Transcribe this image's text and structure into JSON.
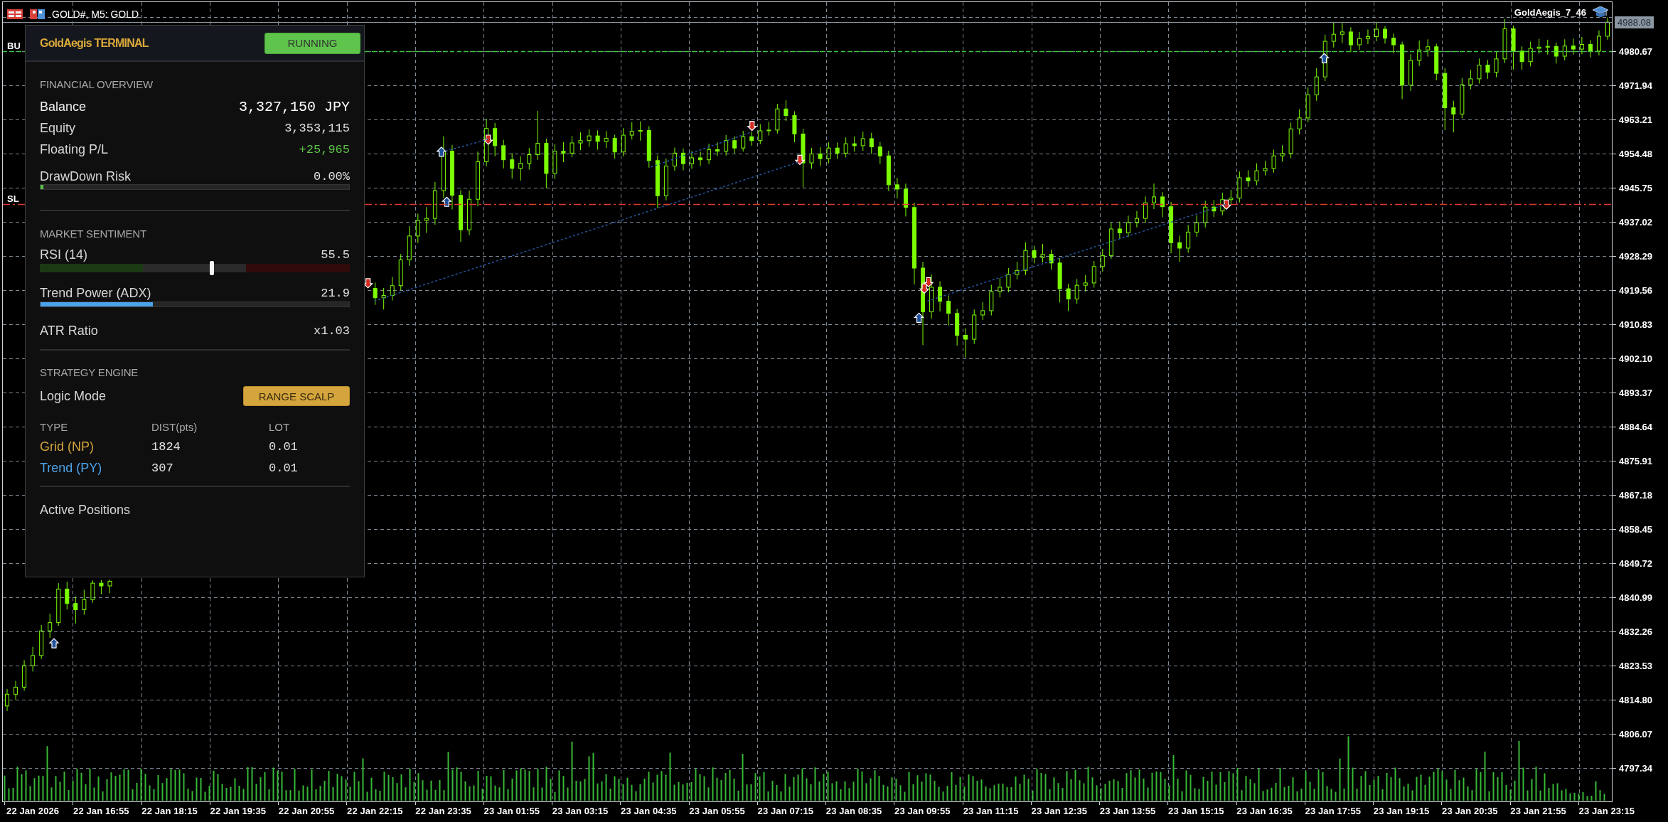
{
  "chart": {
    "title": "GOLD#, M5: GOLD",
    "expert": "GoldAegis_7_46",
    "current_price": "4988.08",
    "level_lines": [
      {
        "label": "BU",
        "kind": "buy"
      },
      {
        "label": "SL",
        "kind": "stop"
      }
    ],
    "chart_data": {
      "type": "candlestick",
      "grid": true,
      "ylim": [
        4788.79,
        4993.22
      ],
      "categories": [
        null,
        null,
        null,
        "22 Jan 2026",
        null,
        null,
        null,
        null,
        null,
        null,
        null,
        "22 Jan 16:55",
        null,
        null,
        null,
        null,
        null,
        null,
        null,
        "22 Jan 18:15",
        null,
        null,
        null,
        null,
        null,
        null,
        null,
        "22 Jan 19:35",
        null,
        null,
        null,
        null,
        null,
        null,
        null,
        "22 Jan 20:55",
        null,
        null,
        null,
        null,
        null,
        null,
        null,
        "22 Jan 22:15",
        null,
        null,
        null,
        null,
        null,
        null,
        null,
        "22 Jan 23:35",
        null,
        null,
        null,
        null,
        null,
        null,
        null,
        "23 Jan 01:55",
        null,
        null,
        null,
        null,
        null,
        null,
        null,
        "23 Jan 03:15",
        null,
        null,
        null,
        null,
        null,
        null,
        null,
        "23 Jan 04:35",
        null,
        null,
        null,
        null,
        null,
        null,
        null,
        "23 Jan 05:55",
        null,
        null,
        null,
        null,
        null,
        null,
        null,
        "23 Jan 07:15",
        null,
        null,
        null,
        null,
        null,
        null,
        null,
        "23 Jan 08:35",
        null,
        null,
        null,
        null,
        null,
        null,
        null,
        "23 Jan 09:55",
        null,
        null,
        null,
        null,
        null,
        null,
        null,
        "23 Jan 11:15",
        null,
        null,
        null,
        null,
        null,
        null,
        null,
        "23 Jan 12:35",
        null,
        null,
        null,
        null,
        null,
        null,
        null,
        "23 Jan 13:55",
        null,
        null,
        null,
        null,
        null,
        null,
        null,
        "23 Jan 15:15",
        null,
        null,
        null,
        null,
        null,
        null,
        null,
        "23 Jan 16:35",
        null,
        null,
        null,
        null,
        null,
        null,
        null,
        "23 Jan 17:55",
        null,
        null,
        null,
        null,
        null,
        null,
        null,
        "23 Jan 19:15",
        null,
        null,
        null,
        null,
        null,
        null,
        null,
        "23 Jan 20:35",
        null,
        null,
        null,
        null,
        null,
        null,
        null,
        "23 Jan 21:55",
        null,
        null,
        null,
        null,
        null,
        null,
        null,
        "23 Jan 23:15"
      ],
      "yticks": [
        {
          "value": 4980.67,
          "label": "4980.67"
        },
        {
          "value": 4971.94,
          "label": "4971.94"
        },
        {
          "value": 4963.21,
          "label": "4963.21"
        },
        {
          "value": 4954.48,
          "label": "4954.48"
        },
        {
          "value": 4945.75,
          "label": "4945.75"
        },
        {
          "value": 4937.02,
          "label": "4937.02"
        },
        {
          "value": 4928.29,
          "label": "4928.29"
        },
        {
          "value": 4919.56,
          "label": "4919.56"
        },
        {
          "value": 4910.83,
          "label": "4910.83"
        },
        {
          "value": 4902.1,
          "label": "4902.10"
        },
        {
          "value": 4893.37,
          "label": "4893.37"
        },
        {
          "value": 4884.64,
          "label": "4884.64"
        },
        {
          "value": 4875.91,
          "label": "4875.91"
        },
        {
          "value": 4867.18,
          "label": "4867.18"
        },
        {
          "value": 4858.45,
          "label": "4858.45"
        },
        {
          "value": 4849.72,
          "label": "4849.72"
        },
        {
          "value": 4840.99,
          "label": "4840.99"
        },
        {
          "value": 4832.26,
          "label": "4832.26"
        },
        {
          "value": 4823.53,
          "label": "4823.53"
        },
        {
          "value": 4814.8,
          "label": "4814.80"
        },
        {
          "value": 4806.07,
          "label": "4806.07"
        },
        {
          "value": 4797.34,
          "label": "4797.34"
        }
      ],
      "ohlc": [
        [
          4813.2,
          4817.5,
          4811.9,
          4816.2
        ],
        [
          4816.2,
          4819.6,
          4814.8,
          4818.0
        ],
        [
          4818.0,
          4824.9,
          4817.1,
          4823.5
        ],
        [
          4823.5,
          4828.3,
          4822.0,
          4826.1
        ],
        [
          4826.1,
          4833.9,
          4825.2,
          4832.4
        ],
        [
          4832.4,
          4836.8,
          4830.6,
          4834.5
        ],
        [
          4834.5,
          4844.6,
          4833.7,
          4843.1
        ],
        [
          4843.1,
          4845.0,
          4837.9,
          4839.4
        ],
        [
          4839.4,
          4841.2,
          4834.3,
          4837.8
        ],
        [
          4837.8,
          4842.9,
          4836.5,
          4840.4
        ],
        [
          4840.4,
          4845.3,
          4839.6,
          4844.6
        ],
        [
          4844.6,
          4845.4,
          4841.8,
          4843.9
        ],
        [
          4843.9,
          4845.5,
          4842.0,
          4845.1
        ],
        null,
        null,
        null,
        null,
        null,
        null,
        null,
        null,
        null,
        null,
        null,
        null,
        null,
        null,
        null,
        null,
        null,
        null,
        null,
        null,
        null,
        null,
        null,
        null,
        null,
        null,
        null,
        null,
        null,
        null,
        [
          4920.0,
          4921.5,
          4915.8,
          4917.6
        ],
        [
          4917.6,
          4920.1,
          4914.6,
          4918.2
        ],
        [
          4918.2,
          4922.9,
          4916.9,
          4920.7
        ],
        [
          4920.7,
          4928.8,
          4919.5,
          4927.3
        ],
        [
          4927.3,
          4935.9,
          4925.8,
          4933.4
        ],
        [
          4933.4,
          4939.1,
          4931.6,
          4937.4
        ],
        [
          4937.4,
          4940.8,
          4934.2,
          4937.9
        ],
        [
          4937.9,
          4947.2,
          4936.3,
          4945.0
        ],
        [
          4945.0,
          4958.9,
          4943.1,
          4955.1
        ],
        [
          4955.1,
          4956.7,
          4940.2,
          4943.8
        ],
        [
          4943.8,
          4945.1,
          4931.9,
          4935.0
        ],
        [
          4935.0,
          4945.0,
          4933.6,
          4942.8
        ],
        [
          4942.8,
          4955.0,
          4941.0,
          4952.4
        ],
        [
          4952.4,
          4963.4,
          4951.2,
          4960.9
        ],
        [
          4960.9,
          4962.3,
          4953.8,
          4956.5
        ],
        [
          4956.5,
          4958.0,
          4950.7,
          4952.9
        ],
        [
          4952.9,
          4954.6,
          4948.1,
          4950.7
        ],
        [
          4950.7,
          4953.8,
          4947.6,
          4952.0
        ],
        [
          4952.0,
          4955.9,
          4950.4,
          4954.2
        ],
        [
          4954.2,
          4965.4,
          4952.8,
          4957.1
        ],
        [
          4957.1,
          4958.3,
          4945.6,
          4949.4
        ],
        [
          4949.4,
          4956.9,
          4948.0,
          4955.1
        ],
        [
          4955.1,
          4957.4,
          4952.3,
          4954.6
        ],
        [
          4954.6,
          4959.0,
          4953.5,
          4957.2
        ],
        [
          4957.2,
          4959.9,
          4955.4,
          4957.8
        ],
        [
          4957.8,
          4960.7,
          4956.2,
          4959.0
        ],
        [
          4959.0,
          4960.4,
          4955.5,
          4957.6
        ],
        [
          4957.6,
          4960.2,
          4955.9,
          4958.4
        ],
        [
          4958.4,
          4959.3,
          4953.2,
          4954.9
        ],
        [
          4954.9,
          4961.0,
          4953.8,
          4959.2
        ],
        [
          4959.2,
          4962.5,
          4958.1,
          4960.2
        ],
        [
          4960.2,
          4962.7,
          4957.8,
          4960.4
        ],
        [
          4960.4,
          4961.5,
          4950.9,
          4952.7
        ],
        [
          4952.7,
          4954.0,
          4940.6,
          4943.7
        ],
        [
          4943.7,
          4953.2,
          4942.5,
          4951.3
        ],
        [
          4951.3,
          4956.0,
          4950.1,
          4954.6
        ],
        [
          4954.6,
          4955.8,
          4950.2,
          4951.9
        ],
        [
          4951.9,
          4955.1,
          4950.6,
          4953.4
        ],
        [
          4953.4,
          4955.0,
          4951.3,
          4952.9
        ],
        [
          4952.9,
          4957.0,
          4951.8,
          4955.5
        ],
        [
          4955.5,
          4957.3,
          4953.9,
          4955.1
        ],
        [
          4955.1,
          4959.2,
          4954.0,
          4957.8
        ],
        [
          4957.8,
          4958.9,
          4954.6,
          4955.9
        ],
        [
          4955.9,
          4960.3,
          4955.0,
          4958.8
        ],
        [
          4958.8,
          4960.1,
          4956.5,
          4957.8
        ],
        [
          4957.8,
          4962.0,
          4956.9,
          4960.3
        ],
        [
          4960.3,
          4962.6,
          4959.1,
          4960.5
        ],
        [
          4960.5,
          4967.2,
          4959.6,
          4965.9
        ],
        [
          4965.9,
          4968.1,
          4962.8,
          4964.2
        ],
        [
          4964.2,
          4965.3,
          4957.4,
          4959.5
        ],
        [
          4959.5,
          4960.8,
          4945.8,
          4952.1
        ],
        [
          4952.1,
          4955.9,
          4950.6,
          4954.4
        ],
        [
          4954.4,
          4956.1,
          4951.3,
          4953.2
        ],
        [
          4953.2,
          4957.4,
          4952.0,
          4955.9
        ],
        [
          4955.9,
          4957.3,
          4953.1,
          4954.6
        ],
        [
          4954.6,
          4958.6,
          4953.5,
          4957.0
        ],
        [
          4957.0,
          4958.9,
          4955.0,
          4956.5
        ],
        [
          4956.5,
          4960.1,
          4955.2,
          4958.3
        ],
        [
          4958.3,
          4959.8,
          4954.4,
          4956.2
        ],
        [
          4956.2,
          4957.5,
          4951.8,
          4953.9
        ],
        [
          4953.9,
          4955.2,
          4944.9,
          4946.5
        ],
        [
          4946.5,
          4948.3,
          4943.0,
          4945.4
        ],
        [
          4945.4,
          4946.8,
          4938.4,
          4940.7
        ],
        [
          4940.7,
          4941.9,
          4921.0,
          4925.2
        ],
        [
          4925.2,
          4926.8,
          4905.5,
          4914.0
        ],
        [
          4914.0,
          4923.6,
          4912.2,
          4920.3
        ],
        [
          4920.3,
          4921.8,
          4914.1,
          4916.7
        ],
        [
          4916.7,
          4918.2,
          4910.5,
          4913.6
        ],
        [
          4913.6,
          4914.7,
          4905.4,
          4908.0
        ],
        [
          4908.0,
          4909.8,
          4902.3,
          4907.0
        ],
        [
          4907.0,
          4914.6,
          4905.8,
          4913.2
        ],
        [
          4913.2,
          4916.5,
          4911.9,
          4914.3
        ],
        [
          4914.3,
          4920.9,
          4913.1,
          4919.2
        ],
        [
          4919.2,
          4922.6,
          4917.7,
          4920.3
        ],
        [
          4920.3,
          4925.2,
          4919.0,
          4923.6
        ],
        [
          4923.6,
          4926.8,
          4922.3,
          4924.6
        ],
        [
          4924.6,
          4931.8,
          4923.4,
          4929.7
        ],
        [
          4929.7,
          4930.9,
          4926.4,
          4927.9
        ],
        [
          4927.9,
          4931.4,
          4926.6,
          4928.7
        ],
        [
          4928.7,
          4929.9,
          4924.8,
          4926.5
        ],
        [
          4926.5,
          4927.7,
          4916.4,
          4919.9
        ],
        [
          4919.9,
          4921.2,
          4914.2,
          4917.3
        ],
        [
          4917.3,
          4922.4,
          4916.0,
          4920.8
        ],
        [
          4920.8,
          4923.4,
          4919.2,
          4921.4
        ],
        [
          4921.4,
          4927.0,
          4920.2,
          4925.6
        ],
        [
          4925.6,
          4930.1,
          4924.3,
          4928.4
        ],
        [
          4928.4,
          4936.8,
          4927.5,
          4935.2
        ],
        [
          4935.2,
          4937.1,
          4932.6,
          4934.2
        ],
        [
          4934.2,
          4938.6,
          4933.1,
          4936.8
        ],
        [
          4936.8,
          4939.8,
          4935.6,
          4937.9
        ],
        [
          4937.9,
          4943.5,
          4936.7,
          4941.9
        ],
        [
          4941.9,
          4946.8,
          4940.3,
          4943.4
        ],
        [
          4943.4,
          4944.6,
          4938.2,
          4940.9
        ],
        [
          4940.9,
          4942.1,
          4929.0,
          4931.7
        ],
        [
          4931.7,
          4933.5,
          4926.8,
          4930.3
        ],
        [
          4930.3,
          4936.2,
          4929.1,
          4934.4
        ],
        [
          4934.4,
          4938.7,
          4933.2,
          4936.8
        ],
        [
          4936.8,
          4942.4,
          4935.6,
          4940.8
        ],
        [
          4940.8,
          4942.6,
          4938.3,
          4939.8
        ],
        [
          4939.8,
          4944.5,
          4938.7,
          4942.7
        ],
        [
          4942.7,
          4945.2,
          4941.5,
          4943.1
        ],
        [
          4943.1,
          4949.9,
          4942.0,
          4948.3
        ],
        [
          4948.3,
          4950.2,
          4946.0,
          4947.5
        ],
        [
          4947.5,
          4952.0,
          4946.4,
          4950.1
        ],
        [
          4950.1,
          4952.6,
          4948.9,
          4950.7
        ],
        [
          4950.7,
          4955.5,
          4949.6,
          4953.9
        ],
        [
          4953.9,
          4956.6,
          4952.4,
          4954.5
        ],
        [
          4954.5,
          4962.4,
          4953.3,
          4960.8
        ],
        [
          4960.8,
          4965.8,
          4959.4,
          4963.6
        ],
        [
          4963.6,
          4971.4,
          4962.5,
          4969.5
        ],
        [
          4969.5,
          4976.3,
          4968.0,
          4974.1
        ],
        [
          4974.1,
          4984.9,
          4973.0,
          4983.2
        ],
        [
          4983.2,
          4988.1,
          4981.6,
          4985.0
        ],
        [
          4985.0,
          4987.9,
          4982.7,
          4985.6
        ],
        [
          4985.6,
          4986.8,
          4980.4,
          4982.3
        ],
        [
          4982.3,
          4985.6,
          4981.0,
          4983.9
        ],
        [
          4983.9,
          4986.2,
          4982.5,
          4984.4
        ],
        [
          4984.4,
          4988.0,
          4983.2,
          4986.3
        ],
        [
          4986.3,
          4987.1,
          4982.6,
          4984.0
        ],
        [
          4984.0,
          4985.2,
          4980.1,
          4982.3
        ],
        [
          4982.3,
          4983.1,
          4968.4,
          4972.0
        ],
        [
          4972.0,
          4979.9,
          4970.5,
          4978.3
        ],
        [
          4978.3,
          4983.4,
          4976.9,
          4981.0
        ],
        [
          4981.0,
          4983.7,
          4979.3,
          4981.8
        ],
        [
          4981.8,
          4982.6,
          4973.2,
          4975.0
        ],
        [
          4975.0,
          4976.3,
          4960.5,
          4966.2
        ],
        [
          4966.2,
          4968.0,
          4959.9,
          4964.6
        ],
        [
          4964.6,
          4973.8,
          4963.5,
          4972.1
        ],
        [
          4972.1,
          4975.9,
          4970.9,
          4973.6
        ],
        [
          4973.6,
          4978.8,
          4972.4,
          4977.1
        ],
        [
          4977.1,
          4978.4,
          4973.6,
          4975.3
        ],
        [
          4975.3,
          4980.5,
          4974.0,
          4978.7
        ],
        [
          4978.7,
          4988.9,
          4977.6,
          4986.4
        ],
        [
          4986.4,
          4987.2,
          4976.0,
          4980.7
        ],
        [
          4980.7,
          4981.9,
          4975.9,
          4978.0
        ],
        [
          4978.0,
          4983.1,
          4976.8,
          4981.4
        ],
        [
          4981.4,
          4983.8,
          4980.1,
          4981.7
        ],
        [
          4981.7,
          4983.6,
          4979.8,
          4981.9
        ],
        [
          4981.9,
          4982.9,
          4977.5,
          4979.4
        ],
        [
          4979.4,
          4983.7,
          4978.3,
          4982.0
        ],
        [
          4982.0,
          4983.9,
          4979.8,
          4981.2
        ],
        [
          4981.2,
          4984.3,
          4979.9,
          4982.4
        ],
        [
          4982.4,
          4983.5,
          4979.1,
          4980.7
        ],
        [
          4980.7,
          4986.0,
          4979.6,
          4984.5
        ],
        [
          4984.5,
          4989.3,
          4983.6,
          4988.1
        ]
      ]
    }
  },
  "panel": {
    "title": "GoldAegis TERMINAL",
    "status": {
      "label": "RUNNING",
      "active": true
    },
    "financial": {
      "heading": "FINANCIAL OVERVIEW",
      "rows": [
        {
          "label": "Balance",
          "value": "3,327,150 JPY",
          "kind": "headline"
        },
        {
          "label": "Equity",
          "value": "3,353,115",
          "kind": "plain"
        },
        {
          "label": "Floating P/L",
          "value": "+25,965",
          "kind": "profit"
        }
      ],
      "drawdown": {
        "label": "DrawDown Risk",
        "value": "0.00%",
        "level": 0.01
      }
    },
    "sentiment": {
      "heading": "MARKET SENTIMENT",
      "rsi": {
        "label": "RSI (14)",
        "value": "55.5",
        "level": 0.555
      },
      "adx": {
        "label": "Trend Power (ADX)",
        "value": "21.9",
        "level": 0.365
      },
      "atr": {
        "label": "ATR Ratio",
        "value": "x1.03"
      }
    },
    "strategy": {
      "heading": "STRATEGY ENGINE",
      "mode_label": "Logic Mode",
      "mode": "RANGE SCALP",
      "columns": [
        "TYPE",
        "DIST(pts)",
        "LOT"
      ],
      "rows": [
        {
          "type": "Grid (NP)",
          "dist": "1824",
          "lot": "0.01",
          "color": "#d4a53c"
        },
        {
          "type": "Trend (PY)",
          "dist": "307",
          "lot": "0.01",
          "color": "#4ba3ea"
        }
      ]
    },
    "positions": {
      "heading": "Active Positions"
    }
  }
}
